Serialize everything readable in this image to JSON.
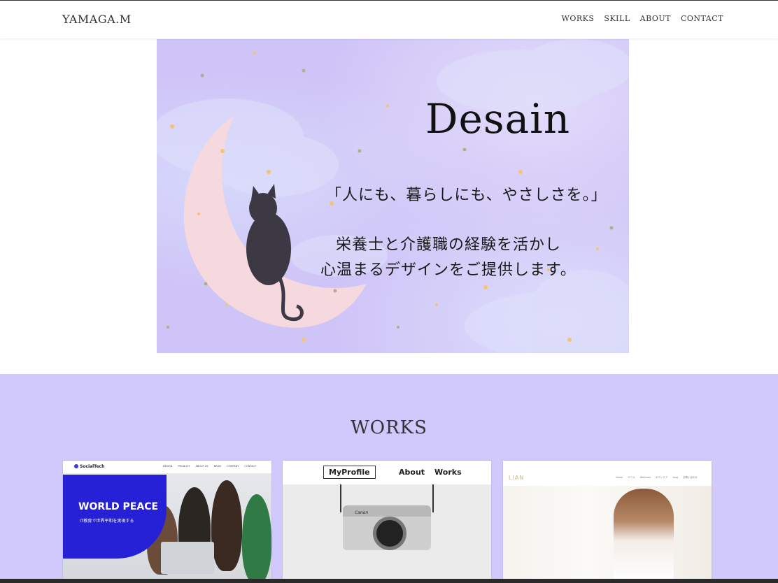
{
  "header": {
    "logo": "YAMAGA.M",
    "nav": [
      "WORKS",
      "SKILL",
      "ABOUT",
      "CONTACT"
    ]
  },
  "hero": {
    "title": "Desain",
    "tagline": "「人にも、暮らしにも、やさしさを。」",
    "desc_line1": "栄養士と介護職の経験を活かし",
    "desc_line2": "心温まるデザインをご提供します。",
    "bg_color": "#cfc4f7"
  },
  "works": {
    "heading": "WORKS",
    "bg_color": "#d1c8fb",
    "cards": [
      {
        "brand": "SocialTech",
        "nav": [
          "DESIGN",
          "PRODUCT",
          "ABOUT US",
          "NEWS",
          "COMPANY",
          "CONTACT"
        ],
        "headline": "WORLD PEACE",
        "subline": "IT教育で世界平和を実現する"
      },
      {
        "logo": "MyProfile",
        "nav": [
          "About",
          "Works"
        ],
        "camera_brand": "Canon"
      },
      {
        "logo": "LIAN",
        "nav": [
          "Home",
          "ミニル",
          "Wellness",
          "ボディケア",
          "blog",
          "お問い合わせ"
        ]
      }
    ]
  }
}
